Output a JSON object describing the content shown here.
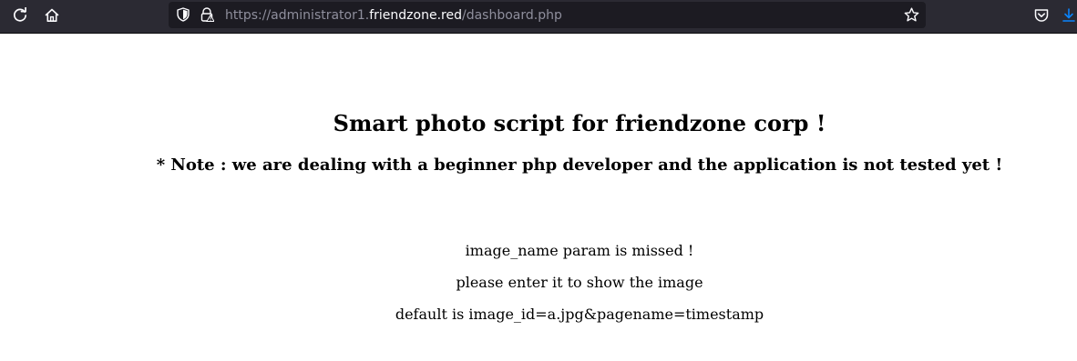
{
  "browser": {
    "url": {
      "prefix": "https://administrator1.",
      "domain": "friendzone.red",
      "path": "/dashboard.php"
    },
    "icons": {
      "reload": "reload-icon",
      "home": "home-icon",
      "tracking": "shield-icon",
      "security": "lock-warning-icon",
      "bookmark": "star-icon",
      "pocket": "pocket-icon",
      "downloads": "download-icon"
    },
    "colors": {
      "toolbar": "#2b2a33",
      "urlbar": "#1c1b22",
      "url_muted": "#8f8f9d",
      "url_domain": "#fbfbfe",
      "download_accent": "#0a84ff"
    }
  },
  "page": {
    "title": "Smart photo script for friendzone corp !",
    "note": "* Note : we are dealing with a beginner php developer and the application is not tested yet !",
    "messages": [
      "image_name param is missed !",
      "please enter it to show the image",
      "default is image_id=a.jpg&pagename=timestamp"
    ]
  }
}
